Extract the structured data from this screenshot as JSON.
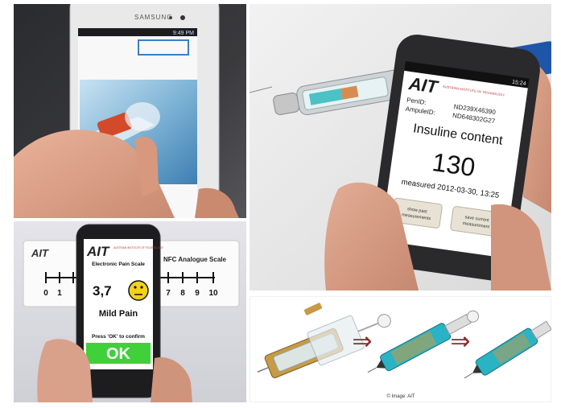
{
  "collage": {
    "panel1": {
      "phone_brand": "SAMSUNG",
      "status_time": "9:49 PM"
    },
    "panel2": {
      "logo": "AIT",
      "logo_subtitle": "AUSTRIAN INSTITUTE OF TECHNOLOGY",
      "status_time": "15:24",
      "pen_id_label": "PenID:",
      "pen_id_value": "ND239X46390",
      "ampule_id_label": "AmpuleID:",
      "ampule_id_value": "ND648302G27",
      "content_title": "Insuline content",
      "content_value": "130",
      "measured_text": "measured 2012-03-30, 13:25",
      "btn_past_line1": "show past",
      "btn_past_line2": "measurements",
      "btn_save_line1": "save current",
      "btn_save_line2": "measurement"
    },
    "panel3": {
      "card_logo": "AIT",
      "nfc_label": "NFC Analogue Scale",
      "scale_numbers": [
        "0",
        "1",
        "7",
        "8",
        "9",
        "10"
      ],
      "phone_logo": "AIT",
      "phone_logo_subtitle": "AUSTRIAN INSTITUTE OF TECHNOLOGY",
      "app_title": "Electronic Pain Scale",
      "pain_value": "3,7",
      "pain_label": "Mild Pain",
      "confirm_text": "Press 'OK' to confirm",
      "ok_label": "OK",
      "colors": {
        "ok_button": "#3fd03a",
        "smiley": "#f2d21b"
      }
    },
    "panel4": {
      "credit": "© Image: AIT",
      "arrow_glyph": "⇒",
      "colors": {
        "arrow": "#8b2a2a",
        "cartridge": "#2ab3c4",
        "gold": "#c89a46"
      }
    }
  }
}
